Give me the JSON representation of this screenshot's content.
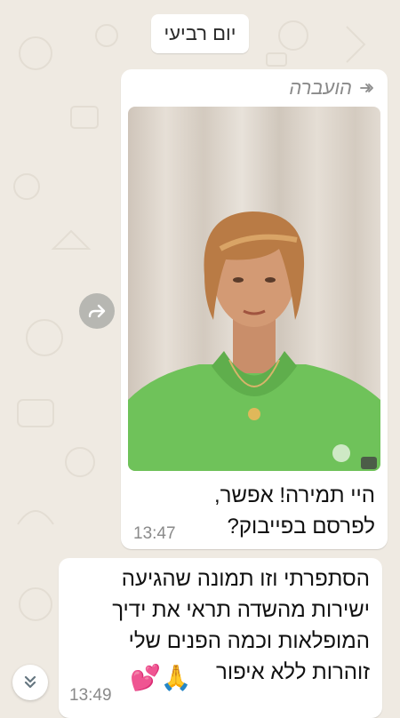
{
  "date_chip": "יום רביעי",
  "forwarded_message": {
    "forwarded_label": "הועברה",
    "text_line1": "היי תמירה! אפשר,",
    "text_line2": "לפרסם בפייבוק?",
    "time": "13:47"
  },
  "reply_message": {
    "lines": [
      "הסתפרתי וזו תמונה שהגיעה",
      "ישירות מהשדה תראי את ידיך",
      "המופלאות וכמה הפנים שלי",
      "זוהרות ללא איפור"
    ],
    "emojis": "💕🙏",
    "time": "13:49"
  },
  "colors": {
    "chat_background": "#efeae2",
    "bubble": "#ffffff",
    "shirt": "#6fc25a",
    "curtain": "#d8d0c6"
  }
}
